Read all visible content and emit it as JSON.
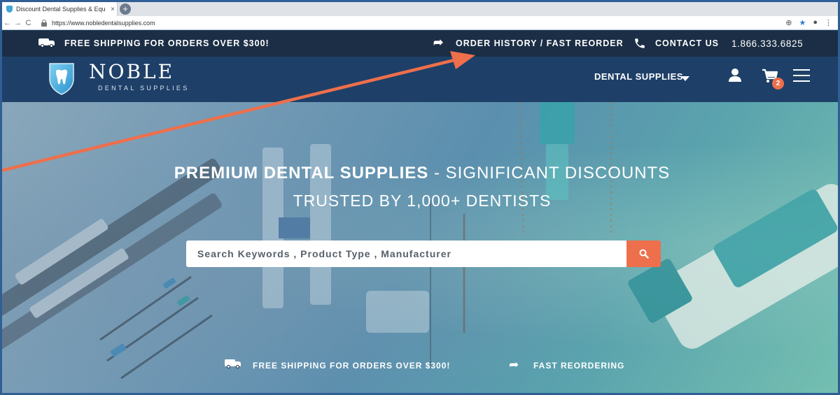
{
  "browser": {
    "tab_title": "Discount Dental Supplies & Equ",
    "tab_close": "×",
    "new_tab": "+",
    "url": "https://www.nobledentalsupplies.com"
  },
  "topbar": {
    "shipping": "FREE SHIPPING FOR ORDERS OVER $300!",
    "order_history": "ORDER HISTORY / FAST REORDER",
    "contact": "CONTACT US",
    "phone": "1.866.333.6825"
  },
  "header": {
    "logo_title": "NOBLE",
    "logo_subtitle": "DENTAL SUPPLIES",
    "nav_dental": "DENTAL SUPPLIES",
    "cart_count": "2"
  },
  "hero": {
    "title_bold": "PREMIUM DENTAL SUPPLIES",
    "title_rest": " - SIGNIFICANT DISCOUNTS",
    "subtitle": "TRUSTED BY 1,000+ DENTISTS",
    "search_placeholder": "Search Keywords , Product Type , Manufacturer"
  },
  "features": {
    "shipping": "FREE SHIPPING FOR ORDERS OVER $300!",
    "reordering": "FAST REORDERING"
  },
  "colors": {
    "topbar": "#1b2e45",
    "header": "#1e4068",
    "accent": "#ee6f4b",
    "arrow": "#ee6f4b"
  },
  "icons": [
    "truck-icon",
    "reorder-arrow-icon",
    "phone-icon",
    "user-icon",
    "cart-icon",
    "menu-icon",
    "search-icon",
    "tooth-shield-icon"
  ]
}
